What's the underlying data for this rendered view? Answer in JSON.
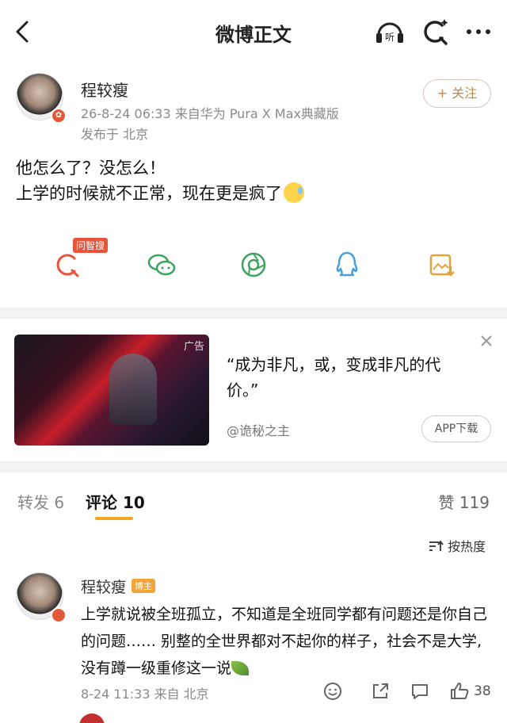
{
  "header": {
    "title": "微博正文"
  },
  "post": {
    "author": "程较瘦",
    "meta": "26-8-24 06:33  来自华为 Pura X Max典藏版",
    "location": "发布于 北京",
    "follow_label": "+ 关注",
    "line1": "他怎么了？没怎么！",
    "line2": "上学的时候就不正常，现在更是疯了"
  },
  "share": {
    "tag": "问智搜"
  },
  "ad": {
    "label": "广告",
    "text": "“成为非凡，或，变成非凡的代价。”",
    "brand": "@诡秘之主",
    "button": "APP下载"
  },
  "tabs": {
    "repost": "转发 6",
    "comment": "评论 10",
    "likes": "赞 119",
    "sort": "按热度"
  },
  "comment": {
    "author": "程较瘦",
    "tag": "博主",
    "text": "上学就说被全班孤立，不知道是全班同学都有问题还是你自己的问题…… 别整的全世界都对不起你的样子，社会不是大学,没有蹲一级重修这一说",
    "meta": "8-24 11:33  来自 北京",
    "like_count": "38"
  },
  "colors": {
    "accent": "#f5a623",
    "brand_red": "#e8533a",
    "follow": "#b98a4e"
  }
}
